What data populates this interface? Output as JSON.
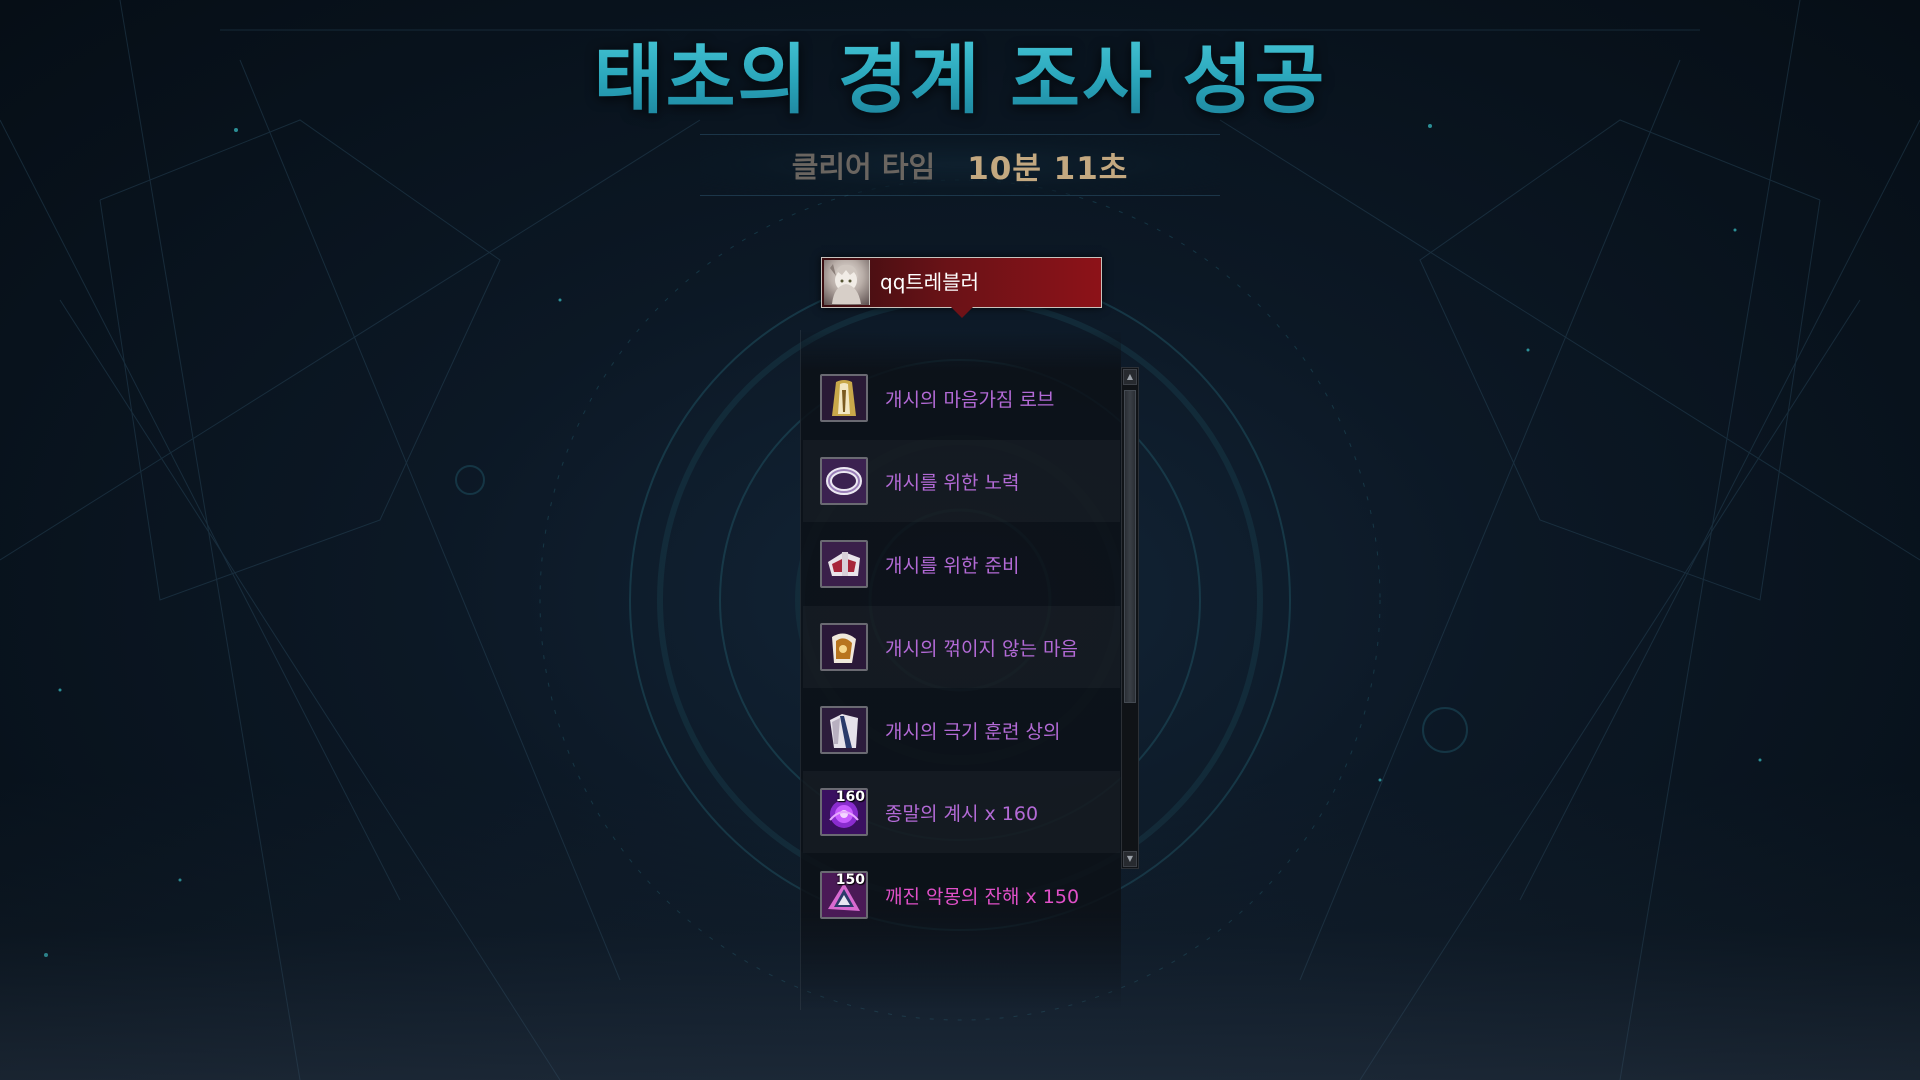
{
  "screen": {
    "title": "태초의 경계 조사 성공",
    "clear_time": {
      "label": "클리어 타임",
      "value": "10분 11초"
    }
  },
  "player": {
    "name": "qq트레블러",
    "icon": "character-portrait-icon"
  },
  "rewards": [
    {
      "name": "개시의 마음가짐 로브",
      "icon": "robe-icon",
      "count": "",
      "color": "#b36ad6"
    },
    {
      "name": "개시를 위한 노력",
      "icon": "ring-icon",
      "count": "",
      "color": "#b36ad6"
    },
    {
      "name": "개시를 위한 준비",
      "icon": "armor-icon",
      "count": "",
      "color": "#b36ad6"
    },
    {
      "name": "개시의 꺾이지 않는 마음",
      "icon": "bracer-icon",
      "count": "",
      "color": "#b36ad6"
    },
    {
      "name": "개시의 극기 훈련 상의",
      "icon": "top-armor-icon",
      "count": "",
      "color": "#b36ad6"
    },
    {
      "name": "종말의 계시 x 160",
      "icon": "purple-orb-icon",
      "count": "160",
      "color": "#b36ad6"
    },
    {
      "name": "깨진 악몽의 잔해 x 150",
      "icon": "shard-icon",
      "count": "150",
      "color": "#e050c8"
    }
  ],
  "colors": {
    "title": "#2fb2c4",
    "clear_value": "#c3a880",
    "player_bar": "#8d1218",
    "epic_item": "#b36ad6",
    "material_item": "#e050c8"
  }
}
